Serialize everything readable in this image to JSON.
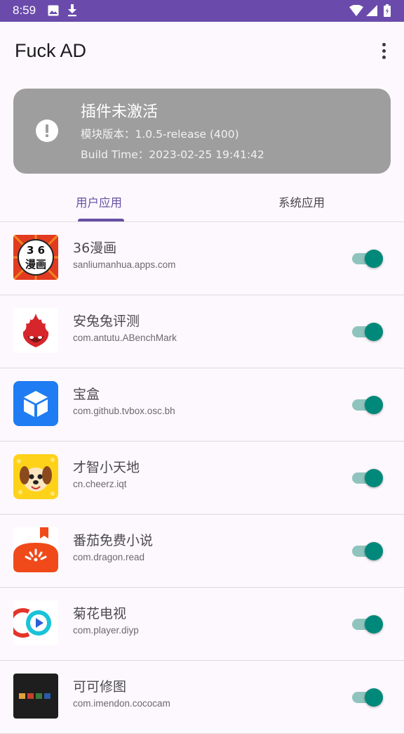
{
  "status_bar": {
    "time": "8:59",
    "icons": [
      "image-icon",
      "download-icon",
      "wifi-icon",
      "signal-icon",
      "battery-icon"
    ]
  },
  "app_bar": {
    "title": "Fuck AD",
    "menu_icon": "more-vert-icon"
  },
  "status_card": {
    "title": "插件未激活",
    "module_version": "模块版本：1.0.5-release (400)",
    "build_time": "Build Time：2023-02-25 19:41:42",
    "icon": "alert-icon",
    "color": "#9e9e9e"
  },
  "tabs": [
    {
      "label": "用户应用",
      "selected": true
    },
    {
      "label": "系统应用",
      "selected": false
    }
  ],
  "apps": [
    {
      "name": "36漫画",
      "package": "sanliumanhua.apps.com",
      "enabled": true,
      "icon_text": "3 6漫画"
    },
    {
      "name": "安兔兔评测",
      "package": "com.antutu.ABenchMark",
      "enabled": true
    },
    {
      "name": "宝盒",
      "package": "com.github.tvbox.osc.bh",
      "enabled": true
    },
    {
      "name": "才智小天地",
      "package": "cn.cheerz.iqt",
      "enabled": true
    },
    {
      "name": "番茄免费小说",
      "package": "com.dragon.read",
      "enabled": true
    },
    {
      "name": "菊花电视",
      "package": "com.player.diyp",
      "enabled": true
    },
    {
      "name": "可可修图",
      "package": "com.imendon.cococam",
      "enabled": true
    }
  ],
  "colors": {
    "accent": "#6750a4",
    "status_bar": "#6a4bab",
    "switch_on": "#00897b"
  }
}
